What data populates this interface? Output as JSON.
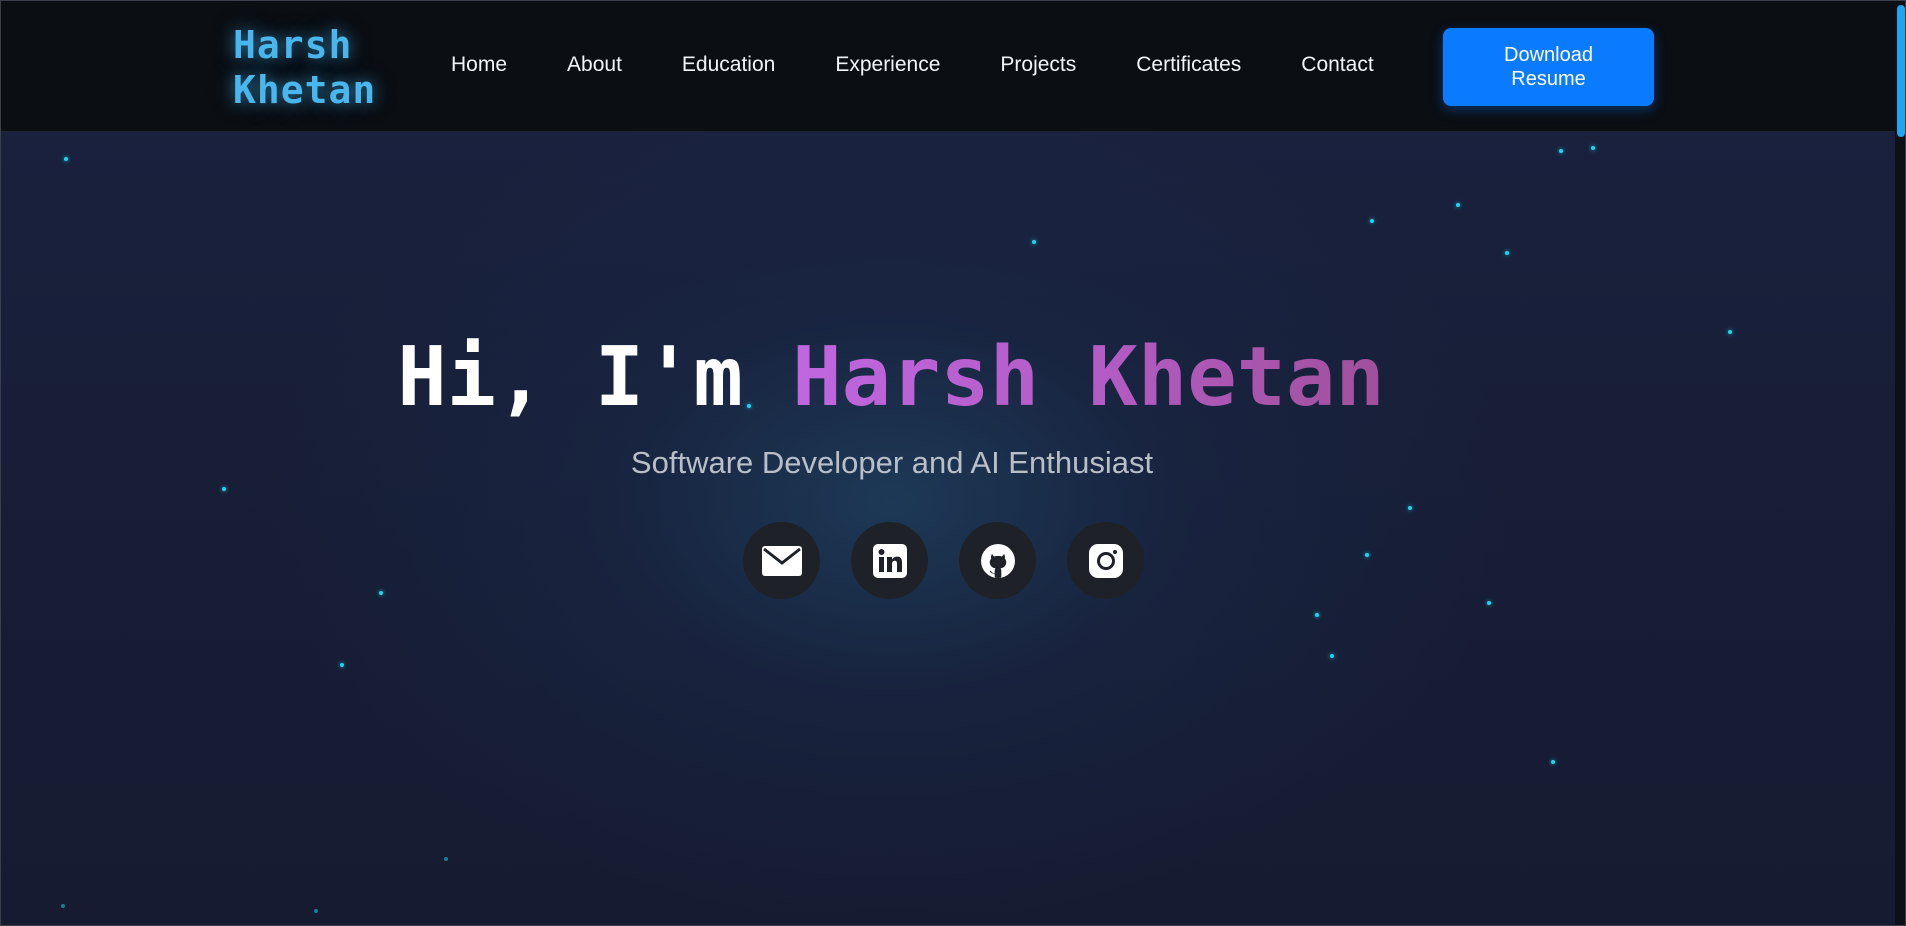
{
  "header": {
    "logo_text": "Harsh Khetan",
    "nav": [
      {
        "label": "Home"
      },
      {
        "label": "About"
      },
      {
        "label": "Education"
      },
      {
        "label": "Experience"
      },
      {
        "label": "Projects"
      },
      {
        "label": "Certificates"
      },
      {
        "label": "Contact"
      }
    ],
    "download_button_label": "Download Resume"
  },
  "hero": {
    "greeting": "Hi, I'm ",
    "name": "Harsh Khetan",
    "subtitle": "Software Developer and AI Enthusiast"
  },
  "socials": [
    {
      "icon": "mail-icon"
    },
    {
      "icon": "linkedin-icon"
    },
    {
      "icon": "github-icon"
    },
    {
      "icon": "instagram-icon"
    }
  ],
  "colors": {
    "accent_blue": "#0a7bff",
    "logo_cyan": "#49b6ee",
    "name_gradient_start": "#c066e0",
    "name_gradient_end": "#a0509a",
    "particle": "#1fd6f0",
    "nav_background": "#0b0e13",
    "hero_background": "#171d33"
  }
}
